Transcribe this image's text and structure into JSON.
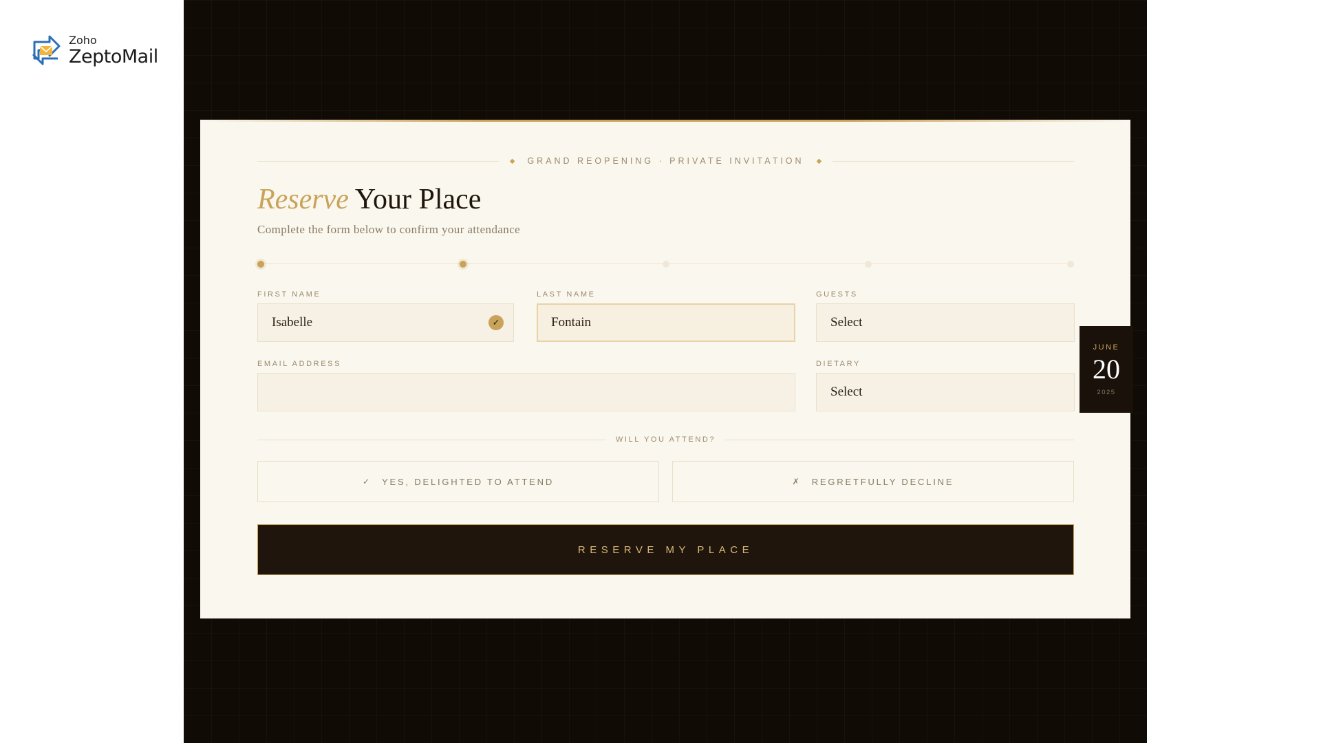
{
  "logo": {
    "small": "Zoho",
    "big": "ZeptoMail"
  },
  "eyebrow": "GRAND REOPENING · PRIVATE INVITATION",
  "title": {
    "accent": "Reserve",
    "rest": "Your Place"
  },
  "subtitle": "Complete the form below to confirm your attendance",
  "progress": {
    "total_steps": 5,
    "active_steps": 2
  },
  "fields": {
    "first_name": {
      "label": "FIRST NAME",
      "value": "Isabelle",
      "valid": true
    },
    "last_name": {
      "label": "LAST NAME",
      "value": "Fontain"
    },
    "guests": {
      "label": "GUESTS",
      "value": "Select"
    },
    "email": {
      "label": "EMAIL ADDRESS",
      "value": ""
    },
    "dietary": {
      "label": "DIETARY",
      "value": "Select"
    }
  },
  "date": {
    "month": "JUNE",
    "day": "20",
    "year": "2025"
  },
  "attend": {
    "label": "WILL YOU ATTEND?",
    "yes": {
      "glyph": "✓",
      "label": "YES, DELIGHTED TO ATTEND"
    },
    "no": {
      "glyph": "✗",
      "label": "REGRETFULLY DECLINE"
    }
  },
  "submit_label": "RESERVE MY PLACE",
  "colors": {
    "accent": "#c9a35a",
    "dark": "#1f150c",
    "card": "#faf7ee"
  },
  "icons": {
    "logo": "zeptomail-logo-icon",
    "check": "check-icon"
  }
}
